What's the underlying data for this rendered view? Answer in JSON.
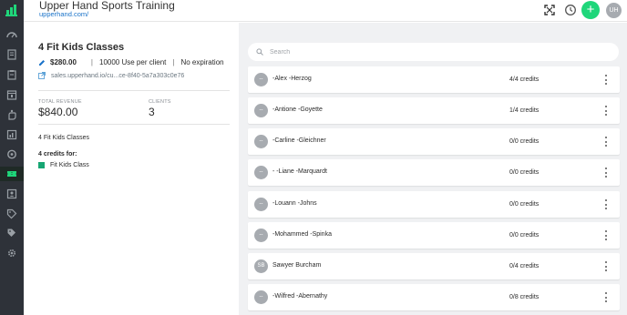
{
  "app": {
    "title": "Upper Hand Sports Training",
    "url": "upperhand.com/"
  },
  "topbar": {
    "icons": [
      "expand-icon",
      "clock-icon"
    ],
    "add_label": "+",
    "user_initials": "UH"
  },
  "sidebar": {
    "items": [
      {
        "icon": "dashboard-icon"
      },
      {
        "icon": "book-icon"
      },
      {
        "icon": "clipboard-icon"
      },
      {
        "icon": "calendar-icon"
      },
      {
        "icon": "hand-icon"
      },
      {
        "icon": "chart-icon"
      },
      {
        "icon": "location-icon"
      },
      {
        "icon": "ticket-icon",
        "active": true
      },
      {
        "icon": "contacts-icon"
      },
      {
        "icon": "tag-icon"
      },
      {
        "icon": "tags-icon"
      },
      {
        "icon": "settings-icon"
      }
    ],
    "active_color": "#1fd67a"
  },
  "package": {
    "title": "4 Fit Kids Classes",
    "price": "$280.00",
    "uses": "10000 Use per client",
    "separator": "|",
    "expiration": "No expiration",
    "link": "sales.upperhand.io/cu...ce-8f40-5a7a303c0e76",
    "total_revenue_label": "TOTAL REVENUE",
    "total_revenue": "$840.00",
    "clients_label": "CLIENTS",
    "clients": "3",
    "description": "4 Fit Kids Classes",
    "credits_for": "4 credits for:",
    "event": "Fit Kids Class",
    "event_color": "#17a673"
  },
  "search": {
    "placeholder": "Search"
  },
  "clients": [
    {
      "initials": "--",
      "name": "-Alex -Herzog",
      "credits": "4/4 credits"
    },
    {
      "initials": "--",
      "name": "-Antione -Goyette",
      "credits": "1/4 credits"
    },
    {
      "initials": "--",
      "name": "-Carline -Gleichner",
      "credits": "0/0 credits"
    },
    {
      "initials": "--",
      "name": "- -Liane -Marquardt",
      "credits": "0/0 credits"
    },
    {
      "initials": "--",
      "name": "-Louann -Johns",
      "credits": "0/0 credits"
    },
    {
      "initials": "--",
      "name": "-Mohammed -Spinka",
      "credits": "0/0 credits"
    },
    {
      "initials": "SB",
      "name": "Sawyer Burcham",
      "credits": "0/4 credits"
    },
    {
      "initials": "--",
      "name": "-Wilfred -Abernathy",
      "credits": "0/8 credits"
    }
  ]
}
